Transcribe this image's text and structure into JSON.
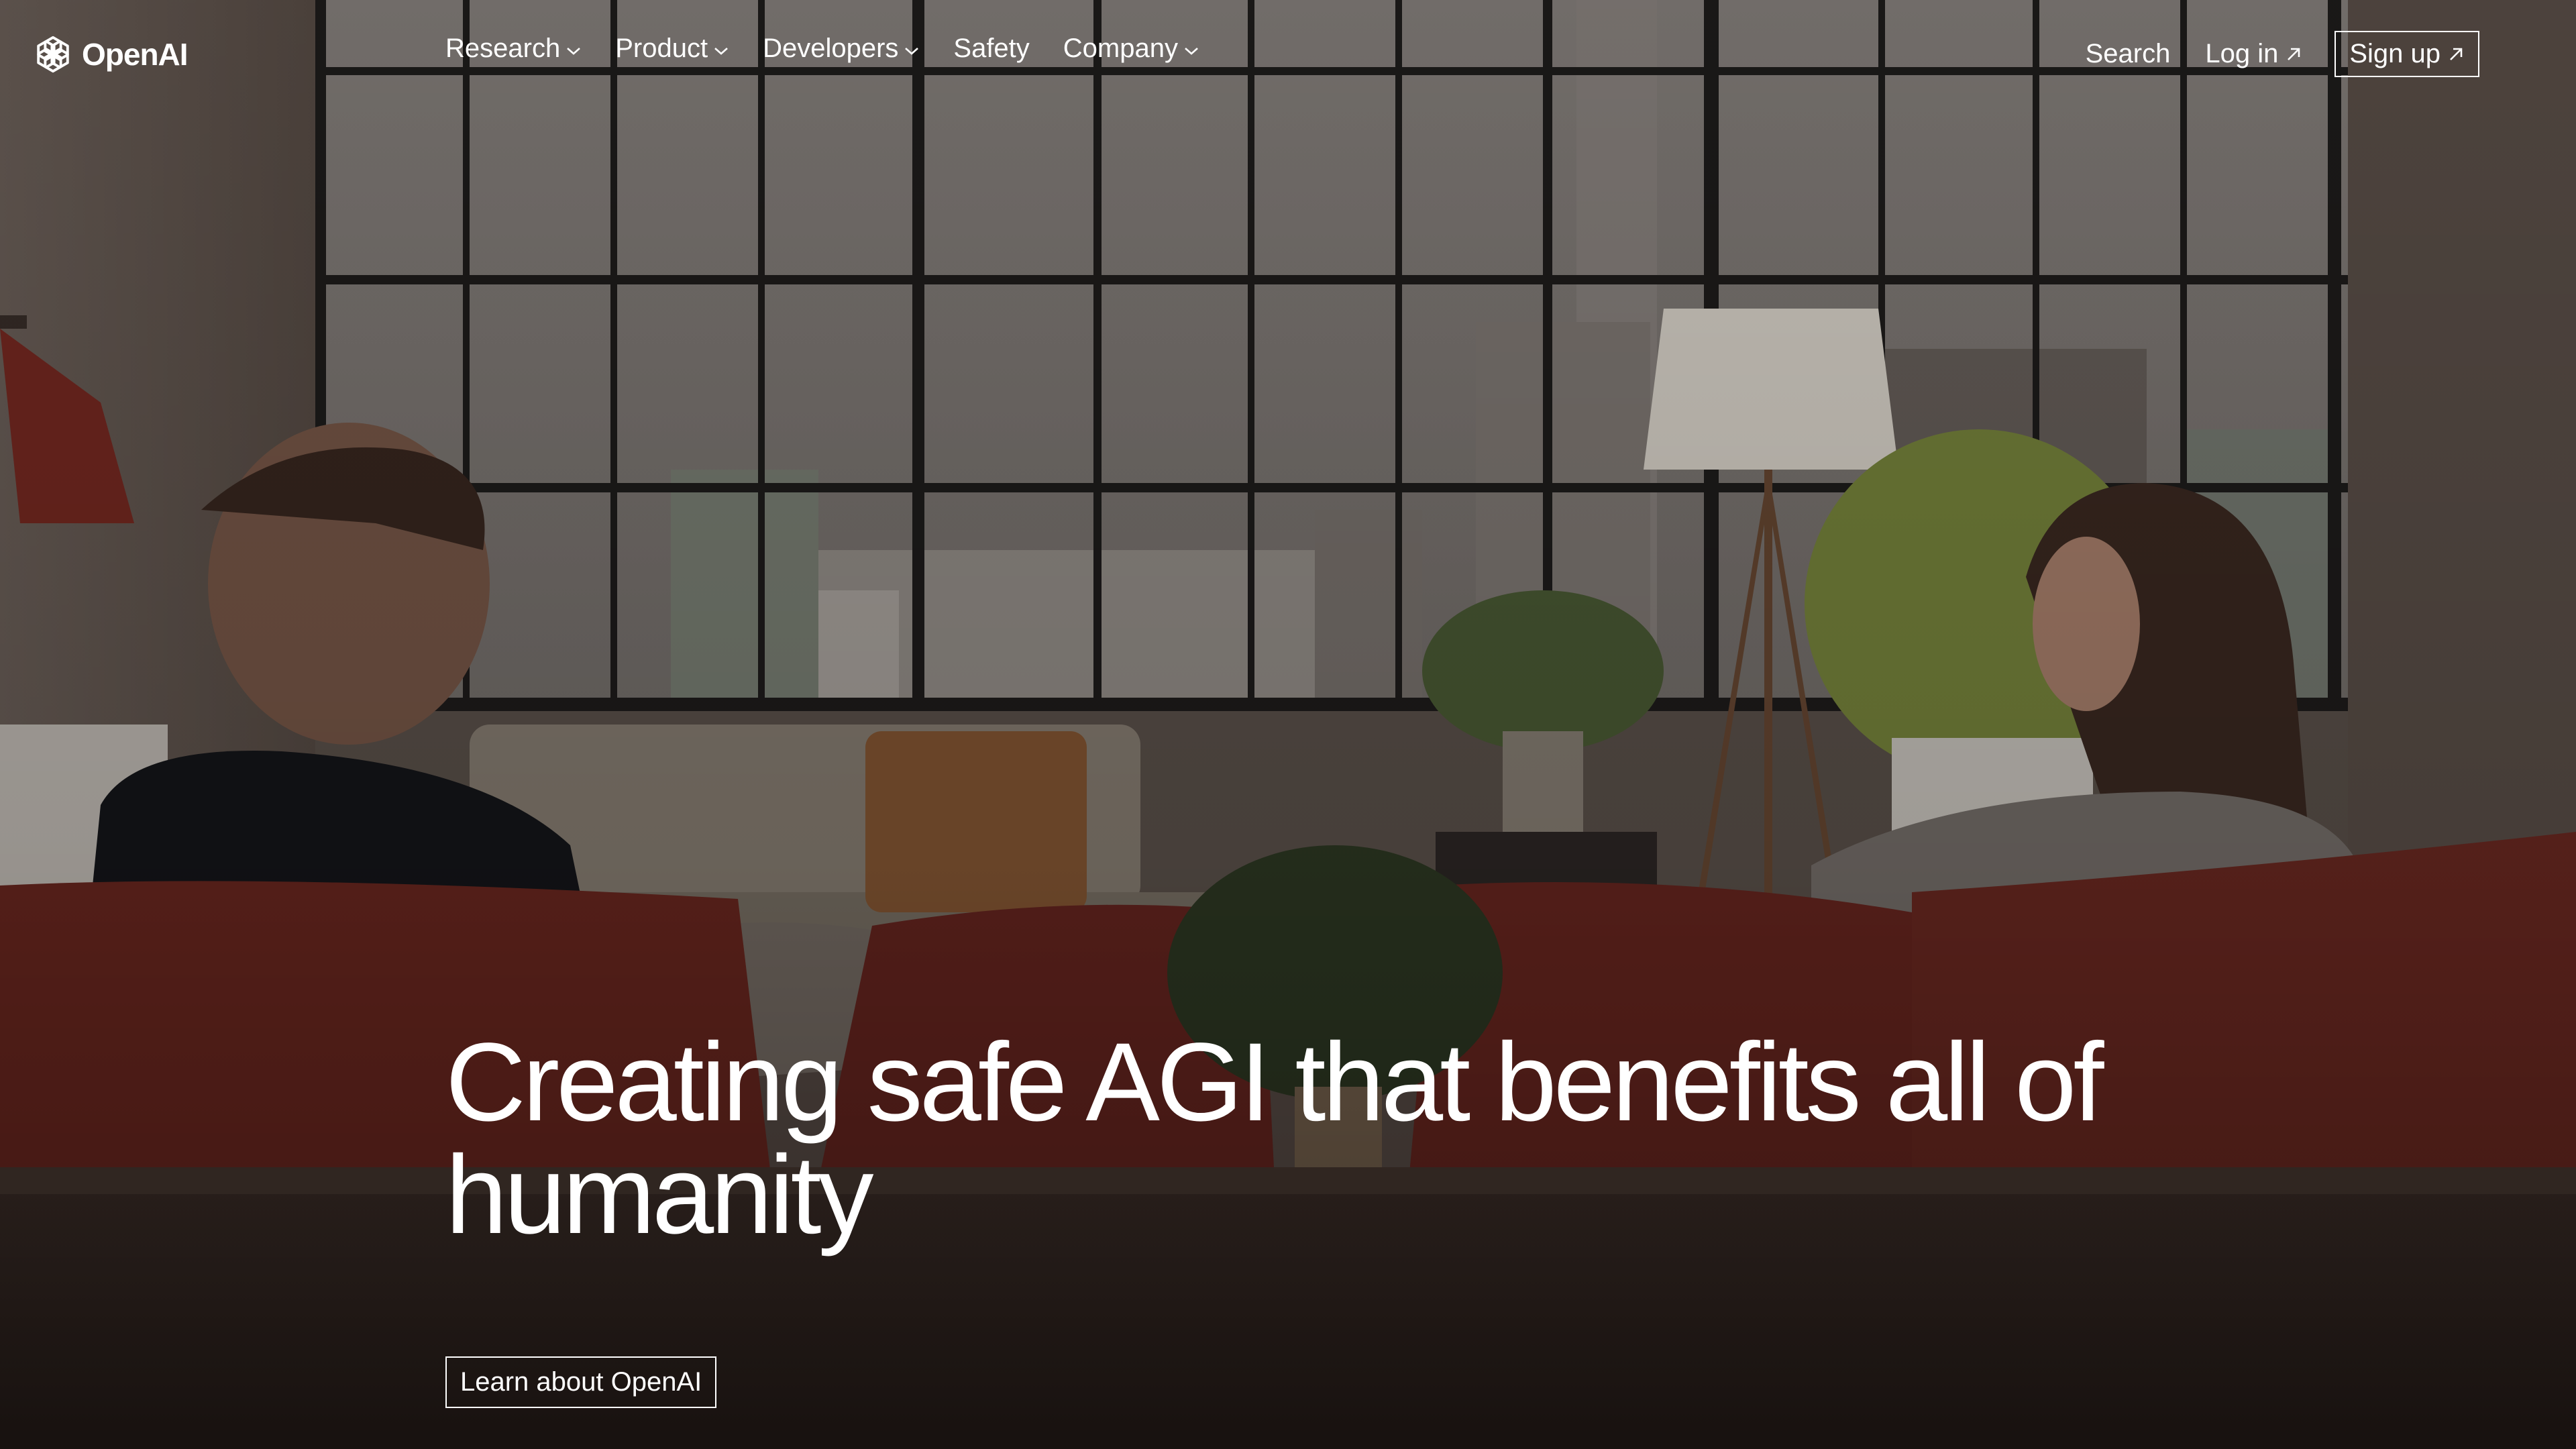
{
  "brand": {
    "name": "OpenAI",
    "logo_icon": "openai-blossom-icon"
  },
  "nav": {
    "items": [
      {
        "label": "Research",
        "icon": "chevron-down-icon"
      },
      {
        "label": "Product",
        "icon": "chevron-down-icon"
      },
      {
        "label": "Developers",
        "icon": "chevron-down-icon"
      },
      {
        "label": "Safety"
      },
      {
        "label": "Company",
        "icon": "chevron-down-icon"
      }
    ],
    "search_label": "Search",
    "login_label": "Log in",
    "signup_label": "Sign up",
    "external_icon": "arrow-up-right-icon"
  },
  "hero": {
    "headline": "Creating safe AGI that benefits all of humanity",
    "cta_label": "Learn about OpenAI",
    "background": "photo of two people sitting on sofas facing each other in a loft with large industrial windows"
  },
  "colors": {
    "text": "#ffffff",
    "overlay": "#2a1f1c"
  }
}
